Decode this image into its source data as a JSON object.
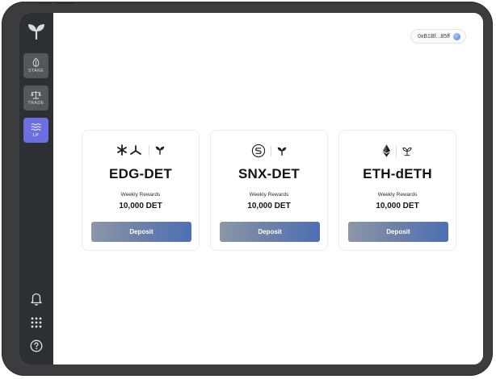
{
  "sidebar": {
    "logo_icon": "sprout-icon",
    "nav": [
      {
        "label": "STAKE",
        "icon": "leaf-icon",
        "active": false
      },
      {
        "label": "TRADE",
        "icon": "scale-icon",
        "active": false
      },
      {
        "label": "LP",
        "icon": "waves-icon",
        "active": true
      }
    ],
    "bottom_icons": [
      "bell-icon",
      "apps-grid-icon",
      "help-icon"
    ]
  },
  "wallet": {
    "address": "0xB1Bf...85ff",
    "avatar_icon": "wallet-avatar-icon"
  },
  "pools": [
    {
      "name": "EDG-DET",
      "rewards_label": "Weekly Rewards",
      "rewards_value": "10,000 DET",
      "button_label": "Deposit",
      "icons": [
        "edgeware-icon",
        "sprout-icon"
      ]
    },
    {
      "name": "SNX-DET",
      "rewards_label": "Weekly Rewards",
      "rewards_value": "10,000 DET",
      "button_label": "Deposit",
      "icons": [
        "synthetix-icon",
        "sprout-icon"
      ]
    },
    {
      "name": "ETH-dETH",
      "rewards_label": "Weekly Rewards",
      "rewards_value": "10,000 DET",
      "button_label": "Deposit",
      "icons": [
        "ethereum-icon",
        "seedling-icon"
      ]
    }
  ],
  "colors": {
    "sidebar_bg": "#2e2f33",
    "nav_item_bg": "#56575b",
    "nav_active_bg": "#6c6fe0",
    "device_frame": "#3c3c3f",
    "button_gradient_start": "#8d97a8",
    "button_gradient_end": "#4d6fb5"
  }
}
